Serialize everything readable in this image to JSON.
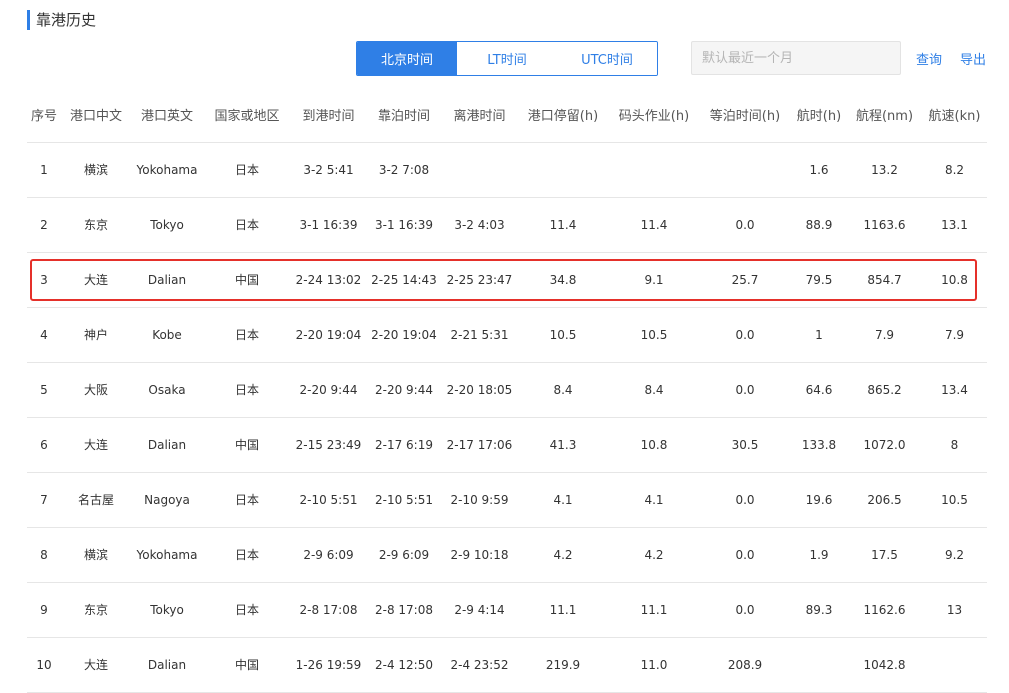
{
  "page_title": "靠港历史",
  "colors": {
    "accent": "#2f7fe6",
    "highlight": "#e5302a"
  },
  "time_modes": [
    {
      "label": "北京时间",
      "active": true
    },
    {
      "label": "LT时间",
      "active": false
    },
    {
      "label": "UTC时间",
      "active": false
    }
  ],
  "search": {
    "placeholder": "默认最近一个月",
    "value": ""
  },
  "actions": {
    "query_label": "查询",
    "export_label": "导出"
  },
  "table": {
    "columns": [
      "序号",
      "港口中文",
      "港口英文",
      "国家或地区",
      "到港时间",
      "靠泊时间",
      "离港时间",
      "港口停留(h)",
      "码头作业(h)",
      "等泊时间(h)",
      "航时(h)",
      "航程(nm)",
      "航速(kn)"
    ],
    "rows": [
      [
        "1",
        "横滨",
        "Yokohama",
        "日本",
        "3-2 5:41",
        "3-2 7:08",
        "",
        "",
        "",
        "",
        "1.6",
        "13.2",
        "8.2"
      ],
      [
        "2",
        "东京",
        "Tokyo",
        "日本",
        "3-1 16:39",
        "3-1 16:39",
        "3-2 4:03",
        "11.4",
        "11.4",
        "0.0",
        "88.9",
        "1163.6",
        "13.1"
      ],
      [
        "3",
        "大连",
        "Dalian",
        "中国",
        "2-24 13:02",
        "2-25 14:43",
        "2-25 23:47",
        "34.8",
        "9.1",
        "25.7",
        "79.5",
        "854.7",
        "10.8"
      ],
      [
        "4",
        "神户",
        "Kobe",
        "日本",
        "2-20 19:04",
        "2-20 19:04",
        "2-21 5:31",
        "10.5",
        "10.5",
        "0.0",
        "1",
        "7.9",
        "7.9"
      ],
      [
        "5",
        "大阪",
        "Osaka",
        "日本",
        "2-20 9:44",
        "2-20 9:44",
        "2-20 18:05",
        "8.4",
        "8.4",
        "0.0",
        "64.6",
        "865.2",
        "13.4"
      ],
      [
        "6",
        "大连",
        "Dalian",
        "中国",
        "2-15 23:49",
        "2-17 6:19",
        "2-17 17:06",
        "41.3",
        "10.8",
        "30.5",
        "133.8",
        "1072.0",
        "8"
      ],
      [
        "7",
        "名古屋",
        "Nagoya",
        "日本",
        "2-10 5:51",
        "2-10 5:51",
        "2-10 9:59",
        "4.1",
        "4.1",
        "0.0",
        "19.6",
        "206.5",
        "10.5"
      ],
      [
        "8",
        "横滨",
        "Yokohama",
        "日本",
        "2-9 6:09",
        "2-9 6:09",
        "2-9 10:18",
        "4.2",
        "4.2",
        "0.0",
        "1.9",
        "17.5",
        "9.2"
      ],
      [
        "9",
        "东京",
        "Tokyo",
        "日本",
        "2-8 17:08",
        "2-8 17:08",
        "2-9 4:14",
        "11.1",
        "11.1",
        "0.0",
        "89.3",
        "1162.6",
        "13"
      ],
      [
        "10",
        "大连",
        "Dalian",
        "中国",
        "1-26 19:59",
        "2-4 12:50",
        "2-4 23:52",
        "219.9",
        "11.0",
        "208.9",
        "",
        "1042.8",
        ""
      ]
    ]
  }
}
